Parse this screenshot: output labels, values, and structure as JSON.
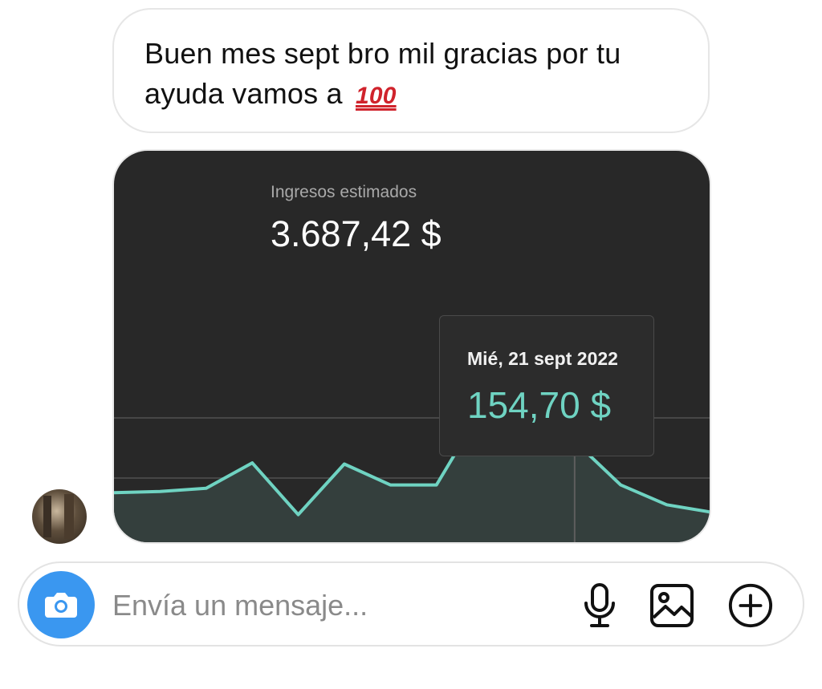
{
  "message": {
    "text": "Buen mes sept bro mil gracias por tu ayuda vamos a",
    "emoji": "100"
  },
  "chart_card": {
    "metric_label": "Ingresos estimados",
    "metric_value": "3.687,42 $",
    "tooltip_date": "Mié, 21 sept 2022",
    "tooltip_value": "154,70 $",
    "line_color": "#6fd3c2",
    "background_color": "#282828"
  },
  "chart_data": {
    "type": "area",
    "title": "Ingresos estimados",
    "ylabel": "",
    "xlabel": "",
    "grid": true,
    "highlighted_point": {
      "x": "Mié, 21 sept 2022",
      "y": 154.7
    },
    "series": [
      {
        "values": [
          108,
          109,
          112,
          135,
          88,
          134,
          115,
          115,
          185,
          147,
          154.7,
          115,
          97,
          90
        ]
      }
    ],
    "ylim": [
      60,
      200
    ]
  },
  "composer": {
    "placeholder": "Envía un mensaje...",
    "icons": [
      "camera-icon",
      "microphone-icon",
      "gallery-icon",
      "add-icon"
    ]
  }
}
